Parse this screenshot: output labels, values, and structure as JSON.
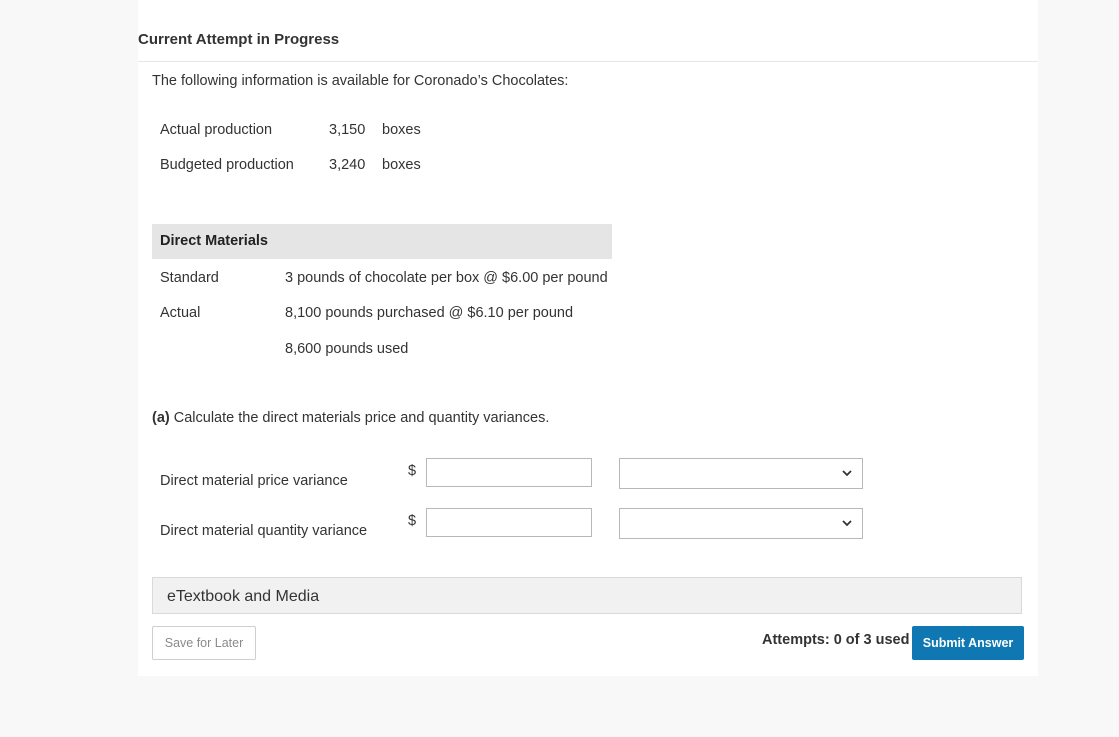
{
  "header": {
    "title": "Current Attempt in Progress"
  },
  "intro": "The following information is available for Coronado’s Chocolates:",
  "production": [
    {
      "label": "Actual production",
      "value": "3,150",
      "unit": "boxes"
    },
    {
      "label": "Budgeted production",
      "value": "3,240",
      "unit": "boxes"
    }
  ],
  "direct_materials": {
    "heading": "Direct Materials",
    "standard_label": "Standard",
    "standard_value": "3 pounds of chocolate per box @ $6.00 per pound",
    "actual_label": "Actual",
    "actual_value_1": "8,100 pounds purchased @ $6.10 per pound",
    "actual_value_2": "8,600 pounds used"
  },
  "question": {
    "part": "(a)",
    "text": "Calculate the direct materials price and quantity variances."
  },
  "answers": [
    {
      "label": "Direct material price variance",
      "currency": "$",
      "value": "",
      "selected": ""
    },
    {
      "label": "Direct material quantity variance",
      "currency": "$",
      "value": "",
      "selected": ""
    }
  ],
  "etextbook": {
    "label": "eTextbook and Media"
  },
  "footer": {
    "save_label": "Save for Later",
    "attempts": "Attempts: 0 of 3 used",
    "submit_label": "Submit Answer"
  },
  "colors": {
    "submit": "#0f78b2",
    "page_bg": "#f8f8f8",
    "header_band": "#e5e5e5"
  }
}
